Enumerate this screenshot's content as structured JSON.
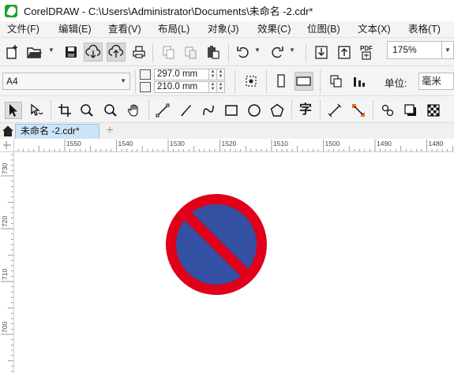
{
  "window": {
    "title": "CorelDRAW - C:\\Users\\Administrator\\Documents\\未命名 -2.cdr*"
  },
  "menu": {
    "items": [
      "文件(F)",
      "编辑(E)",
      "查看(V)",
      "布局(L)",
      "对象(J)",
      "效果(C)",
      "位图(B)",
      "文本(X)",
      "表格(T)"
    ]
  },
  "standard_toolbar": {
    "icons": [
      "new-document-icon",
      "open-icon",
      "save-icon",
      "cloud-download-icon",
      "cloud-upload-icon",
      "print-icon",
      "copy-icon",
      "paste-icon",
      "clipboard-icon",
      "undo-icon",
      "redo-icon",
      "import-icon",
      "export-icon",
      "publish-pdf-icon"
    ],
    "pdf_label": "PDF",
    "zoom_level": "175%"
  },
  "property_bar": {
    "page_size": "A4",
    "width": "297.0 mm",
    "height": "210.0 mm",
    "units_label": "单位:",
    "units_value": "毫米"
  },
  "toolbox": {
    "icons": [
      "pick-tool-icon",
      "shape-tool-icon",
      "crop-tool-icon",
      "zoom-tool-icon",
      "zoom-out-icon",
      "pan-tool-icon",
      "freehand-tool-icon",
      "artistic-media-icon",
      "bezier-icon",
      "rectangle-tool-icon",
      "ellipse-tool-icon",
      "polygon-tool-icon",
      "text-tool-icon",
      "parallel-dimension-icon",
      "connector-tool-icon",
      "blend-tool-icon",
      "drop-shadow-icon",
      "transparency-icon"
    ],
    "text_tool_glyph": "字"
  },
  "tabs": {
    "document_tab": "未命名 -2.cdr*",
    "add_tab": "+"
  },
  "rulers": {
    "horizontal_labels": [
      "1550",
      "1540",
      "1530",
      "1520",
      "1510",
      "1500",
      "1490",
      "1480"
    ],
    "vertical_labels": [
      "730",
      "720",
      "710",
      "700"
    ]
  },
  "drawing": {
    "shape": "no-parking-sign",
    "ring_color": "#e00019",
    "fill_color": "#3450a2",
    "slash_color": "#e00019"
  }
}
